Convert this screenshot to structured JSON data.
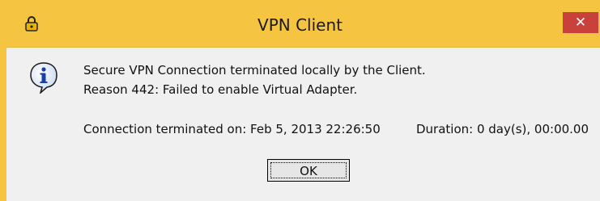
{
  "window": {
    "title": "VPN Client",
    "close_label": "✕",
    "app_icon": "padlock-icon"
  },
  "dialog": {
    "icon": "info-icon",
    "message_line1": "Secure VPN Connection terminated locally by the Client.",
    "message_line2": "Reason 442: Failed to enable Virtual Adapter.",
    "terminated_on": "Connection terminated on: Feb 5, 2013 22:26:50",
    "duration": "Duration: 0 day(s), 00:00.00",
    "ok_label": "OK"
  },
  "colors": {
    "titlebar": "#f5c542",
    "close_button": "#c9413b",
    "client_area": "#f0f0f0"
  }
}
